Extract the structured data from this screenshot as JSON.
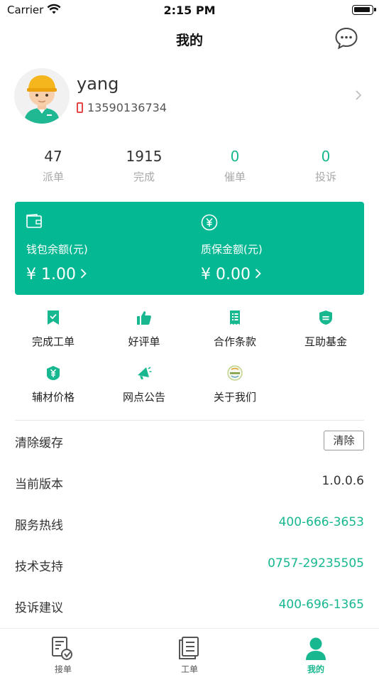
{
  "status_bar": {
    "carrier": "Carrier",
    "time": "2:15 PM"
  },
  "nav": {
    "title": "我的",
    "message_icon": "chat-bubble-icon"
  },
  "profile": {
    "username": "yang",
    "phone": "13590136734"
  },
  "stats": [
    {
      "value": "47",
      "label": "派单",
      "highlight": false
    },
    {
      "value": "1915",
      "label": "完成",
      "highlight": false
    },
    {
      "value": "0",
      "label": "催单",
      "highlight": true
    },
    {
      "value": "0",
      "label": "投诉",
      "highlight": true
    }
  ],
  "wallet": {
    "balance_label": "钱包余额(元)",
    "balance_value": "¥ 1.00",
    "deposit_label": "质保金额(元)",
    "deposit_value": "¥ 0.00",
    "color": "#05b894"
  },
  "grid": [
    {
      "label": "完成工单",
      "icon": "bookmark-check-icon"
    },
    {
      "label": "好评单",
      "icon": "thumbs-up-icon"
    },
    {
      "label": "合作条款",
      "icon": "document-list-icon"
    },
    {
      "label": "互助基金",
      "icon": "fund-badge-icon"
    },
    {
      "label": "辅材价格",
      "icon": "price-tag-icon"
    },
    {
      "label": "网点公告",
      "icon": "megaphone-icon"
    },
    {
      "label": "关于我们",
      "icon": "company-logo-icon"
    }
  ],
  "settings": {
    "clear_cache_label": "清除缓存",
    "clear_button": "清除",
    "version_label": "当前版本",
    "version_value": "1.0.0.6",
    "hotline_label": "服务热线",
    "hotline_value": "400-666-3653",
    "support_label": "技术支持",
    "support_value": "0757-29235505",
    "complaint_label": "投诉建议",
    "complaint_value": "400-696-1365"
  },
  "tabs": [
    {
      "label": "接单",
      "icon": "receive-order-icon",
      "active": false
    },
    {
      "label": "工单",
      "icon": "work-order-icon",
      "active": false
    },
    {
      "label": "我的",
      "icon": "profile-icon",
      "active": true
    }
  ],
  "accent_color": "#17b890"
}
